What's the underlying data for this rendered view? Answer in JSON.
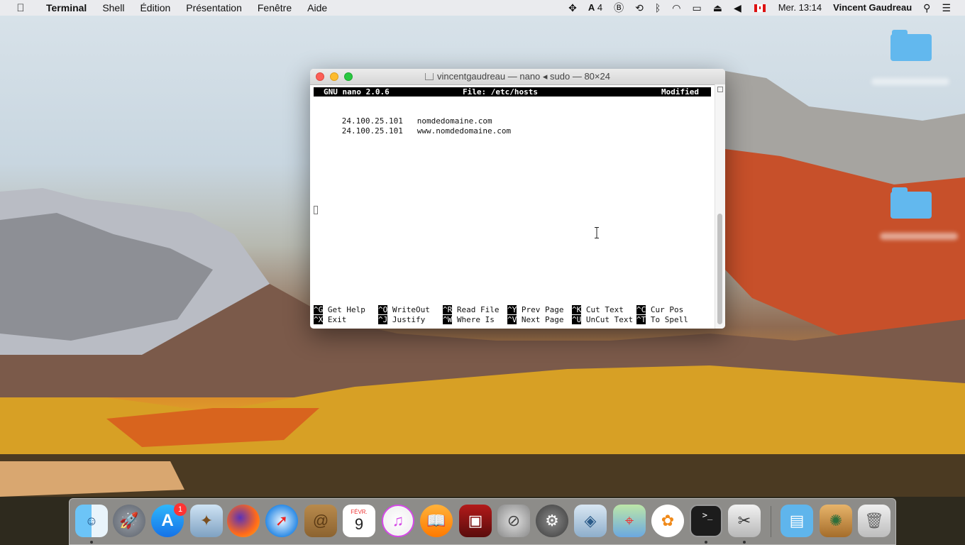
{
  "menubar": {
    "app_name": "Terminal",
    "menus": [
      "Shell",
      "Édition",
      "Présentation",
      "Fenêtre",
      "Aide"
    ],
    "status_text_4": "4",
    "clock": "Mer. 13:14",
    "user": "Vincent Gaudreau"
  },
  "window": {
    "title": "vincentgaudreau — nano ◂ sudo — 80×24"
  },
  "nano": {
    "version": "GNU nano 2.0.6",
    "file": "File: /etc/hosts",
    "status": "Modified",
    "lines": [
      {
        "ip": "24.100.25.101",
        "host": "nomdedomaine.com"
      },
      {
        "ip": "24.100.25.101",
        "host": "www.nomdedomaine.com"
      }
    ],
    "shortcuts_row1": [
      {
        "key": "^G",
        "label": "Get Help"
      },
      {
        "key": "^O",
        "label": "WriteOut"
      },
      {
        "key": "^R",
        "label": "Read File"
      },
      {
        "key": "^Y",
        "label": "Prev Page"
      },
      {
        "key": "^K",
        "label": "Cut Text"
      },
      {
        "key": "^C",
        "label": "Cur Pos"
      }
    ],
    "shortcuts_row2": [
      {
        "key": "^X",
        "label": "Exit"
      },
      {
        "key": "^J",
        "label": "Justify"
      },
      {
        "key": "^W",
        "label": "Where Is"
      },
      {
        "key": "^V",
        "label": "Next Page"
      },
      {
        "key": "^U",
        "label": "UnCut Text"
      },
      {
        "key": "^T",
        "label": "To Spell"
      }
    ]
  },
  "dock": {
    "calendar_month": "FÉVR.",
    "calendar_day": "9",
    "appstore_badge": "1",
    "icons": [
      "finder-icon",
      "launchpad-icon",
      "app-store-icon",
      "preview-icon",
      "firefox-icon",
      "safari-icon",
      "contacts-icon",
      "calendar-icon",
      "itunes-icon",
      "ibooks-icon",
      "photo-booth-icon",
      "disk-utility-icon",
      "system-preferences-icon",
      "virtualbox-icon",
      "maps-icon",
      "photos-icon",
      "terminal-icon",
      "scissors-icon",
      "folder-icon",
      "installer-icon",
      "trash-icon"
    ]
  }
}
